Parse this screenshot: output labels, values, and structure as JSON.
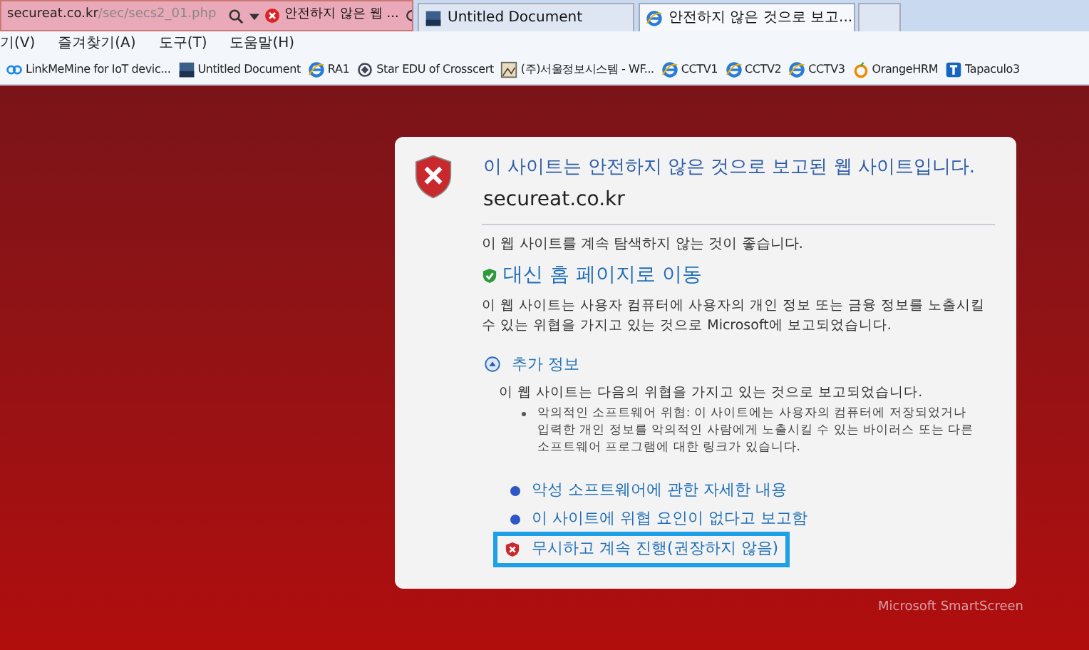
{
  "address_bar": {
    "url_host": "secureat.co.kr",
    "url_path": "/sec/secs2_01.php",
    "site_label": "안전하지 않은 웹 ..."
  },
  "tabs": [
    {
      "title": "Untitled Document",
      "kind": "sun",
      "selected": false
    },
    {
      "title": "안전하지 않은 것으로 보고...",
      "kind": "ie",
      "selected": true
    }
  ],
  "menu": [
    "기(V)",
    "즐겨찾기(A)",
    "도구(T)",
    "도움말(H)"
  ],
  "favorites": [
    {
      "label": "LinkMeMine for IoT devic...",
      "kind": "link"
    },
    {
      "label": "Untitled Document",
      "kind": "sun"
    },
    {
      "label": "RA1",
      "kind": "ie"
    },
    {
      "label": "Star EDU of Crosscert",
      "kind": "star"
    },
    {
      "label": "(주)서울정보시스템 - WF...",
      "kind": "image"
    },
    {
      "label": "CCTV1",
      "kind": "ie"
    },
    {
      "label": "CCTV2",
      "kind": "ie"
    },
    {
      "label": "CCTV3",
      "kind": "ie"
    },
    {
      "label": "OrangeHRM",
      "kind": "orange"
    },
    {
      "label": "Tapaculo3",
      "kind": "tapaculo"
    }
  ],
  "warning": {
    "title": "이 사이트는 안전하지 않은 것으로 보고된 웹 사이트입니다.",
    "domain": "secureat.co.kr",
    "advice": "이 웹 사이트를 계속 탐색하지 않는 것이 좋습니다.",
    "home_link": "대신 홈 페이지로 이동",
    "description": "이 웹 사이트는 사용자 컴퓨터에 사용자의 개인 정보 또는 금융 정보를 노출시킬 수 있는 위협을 가지고 있는 것으로 Microsoft에 보고되었습니다.",
    "more_info": {
      "label": "추가 정보",
      "expanded": true,
      "intro": "이 웹 사이트는 다음의 위협을 가지고 있는 것으로 보고되었습니다.",
      "threats": [
        "악의적인 소프트웨어 위협: 이 사이트에는 사용자의 컴퓨터에 저장되었거나 입력한 개인 정보를 악의적인 사람에게 노출시킬 수 있는 바이러스 또는 다른 소프트웨어 프로그램에 대한 링크가 있습니다."
      ]
    },
    "links": [
      "악성 소프트웨어에 관한 자세한 내용",
      "이 사이트에 위협 요인이 없다고 보고함"
    ],
    "proceed": {
      "label": "무시하고 계속 진행(권장하지 않음)",
      "focused": true
    }
  },
  "footer": "Microsoft SmartScreen"
}
